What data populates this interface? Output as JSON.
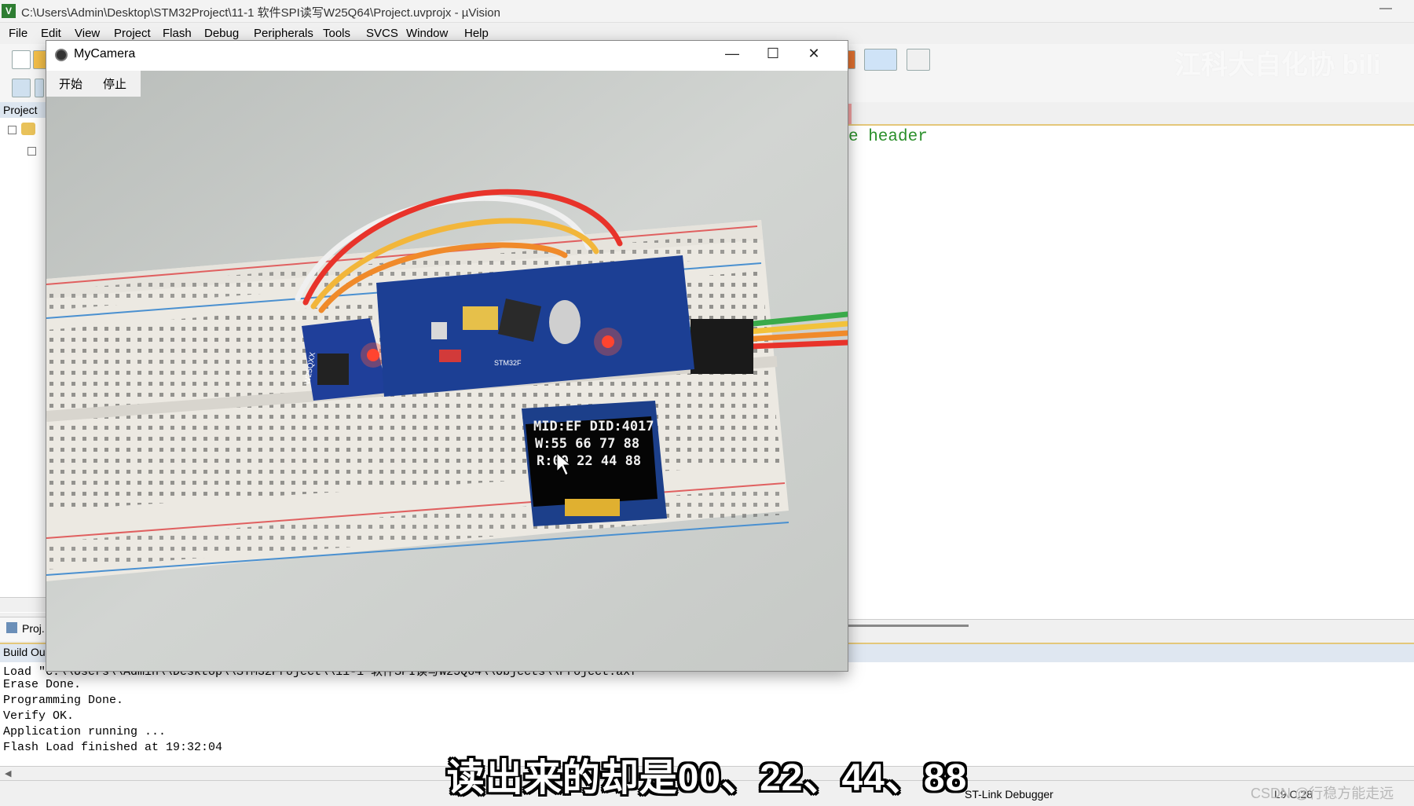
{
  "window": {
    "title": "C:\\Users\\Admin\\Desktop\\STM32Project\\11-1 软件SPI读写W25Q64\\Project.uvprojx - µVision",
    "minimize_glyph": "—"
  },
  "menu": [
    "File",
    "Edit",
    "View",
    "Project",
    "Flash",
    "Debug",
    "Peripherals",
    "Tools",
    "SVCS",
    "Window",
    "Help"
  ],
  "project_panel": {
    "header": "Project",
    "tab": "Proj..."
  },
  "editor": {
    "visible_code": "e header"
  },
  "build_output": {
    "label": "Build Ou",
    "lines": [
      "Load \"C:\\\\Users\\\\Admin\\\\Desktop\\\\STM32Project\\\\11-1 软件SPI读写W25Q64\\\\Objects\\\\Project.axf\"",
      "Erase Done.",
      "Programming Done.",
      "Verify OK.",
      "Application running ...",
      "Flash Load finished at 19:32:04"
    ]
  },
  "status_bar": {
    "debugger": "ST-Link Debugger",
    "position": "L9 C:28",
    "watermark": "CSDN @行稳方能走远"
  },
  "subtitle": "读出来的却是00、22、44、88",
  "camera_window": {
    "title": "MyCamera",
    "start_button": "开始",
    "stop_button": "停止",
    "oled_lines": [
      "MID:EF  DID:4017",
      "W:55 66 77 88",
      "R:00 22 44 88"
    ],
    "module_label": "W25QXX",
    "board_label": "STM32F"
  },
  "watermark_logo": "江科大自化协 bili"
}
